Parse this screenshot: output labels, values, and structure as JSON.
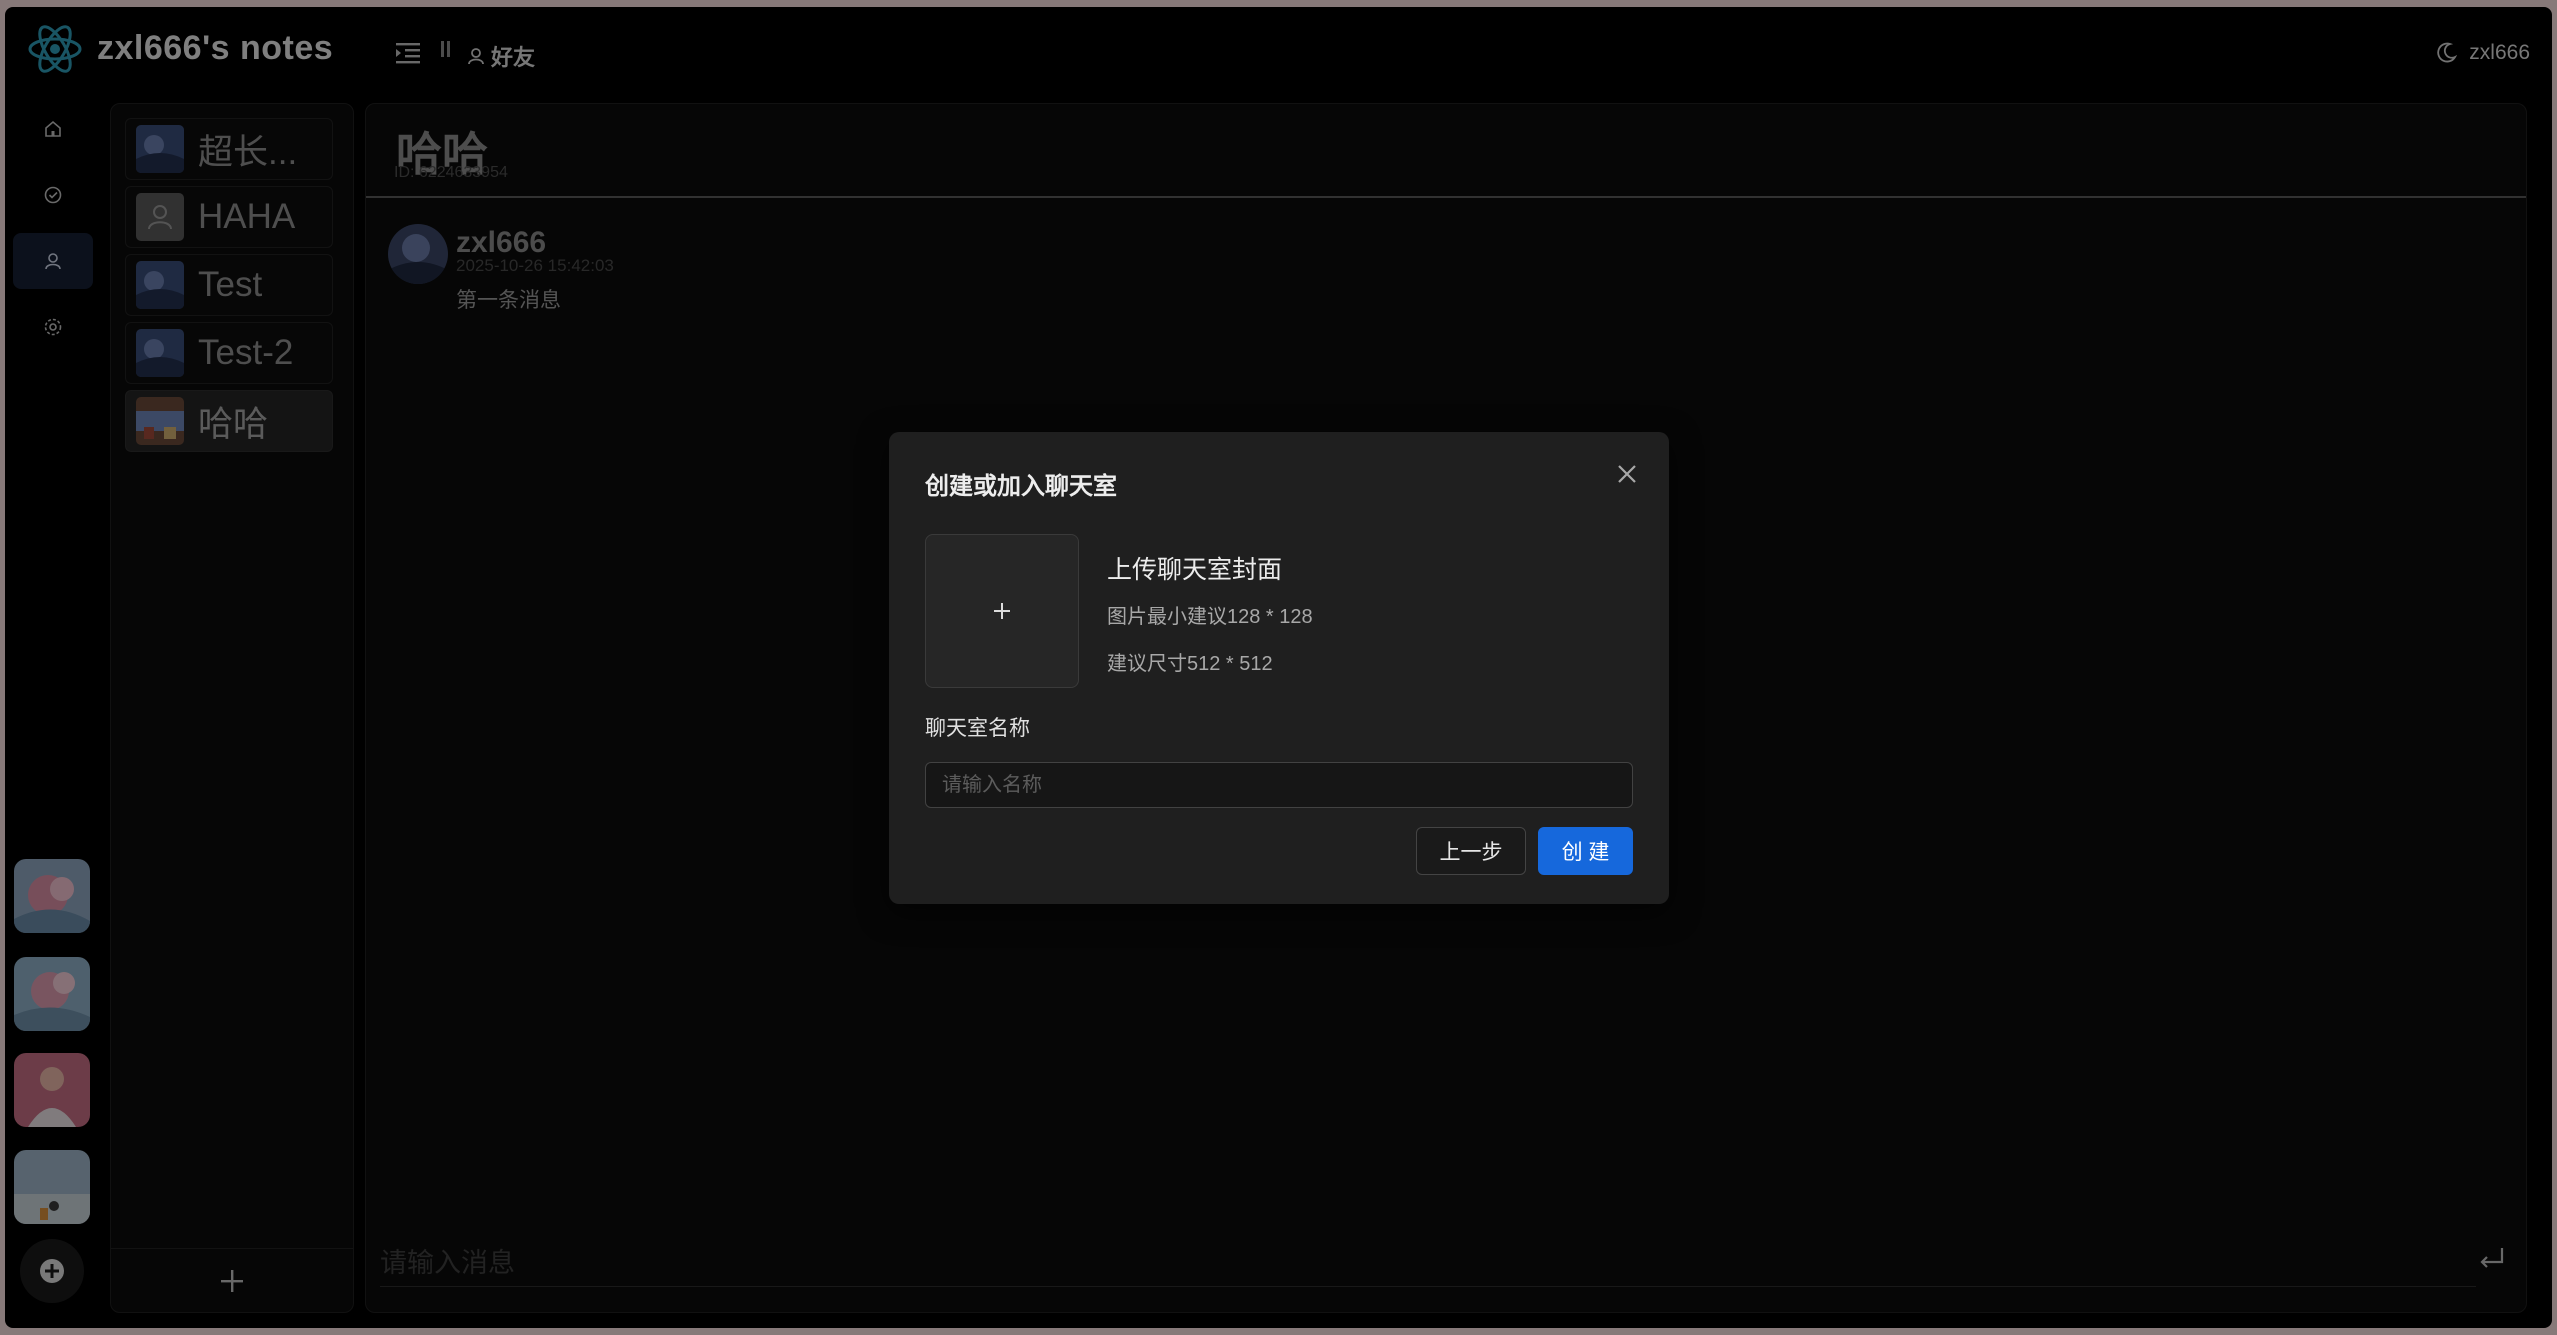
{
  "header": {
    "app_title": "zxl666's notes",
    "breadcrumb": "好友",
    "username": "zxl666"
  },
  "rail": {
    "items": [
      "home-icon",
      "check-circle-icon",
      "user-icon",
      "settings-icon"
    ],
    "active_index": 2
  },
  "chat_list": {
    "items": [
      {
        "name": "超长..."
      },
      {
        "name": "HAHA"
      },
      {
        "name": "Test"
      },
      {
        "name": "Test-2"
      },
      {
        "name": "哈哈"
      }
    ],
    "active_index": 4
  },
  "room": {
    "title": "哈哈",
    "id": "ID: 6224633954",
    "messages": [
      {
        "user": "zxl666",
        "time": "2025-10-26 15:42:03",
        "text": "第一条消息"
      }
    ],
    "composer_placeholder": "请输入消息"
  },
  "modal": {
    "title": "创建或加入聊天室",
    "upload_title": "上传聊天室封面",
    "hint_min": "图片最小建议128 * 128",
    "hint_size": "建议尺寸512 * 512",
    "name_label": "聊天室名称",
    "name_placeholder": "请输入名称",
    "prev_label": "上一步",
    "create_label": "创 建"
  },
  "colors": {
    "primary": "#1668dc",
    "background": "#000000",
    "modal_bg": "#1f1f1f"
  }
}
